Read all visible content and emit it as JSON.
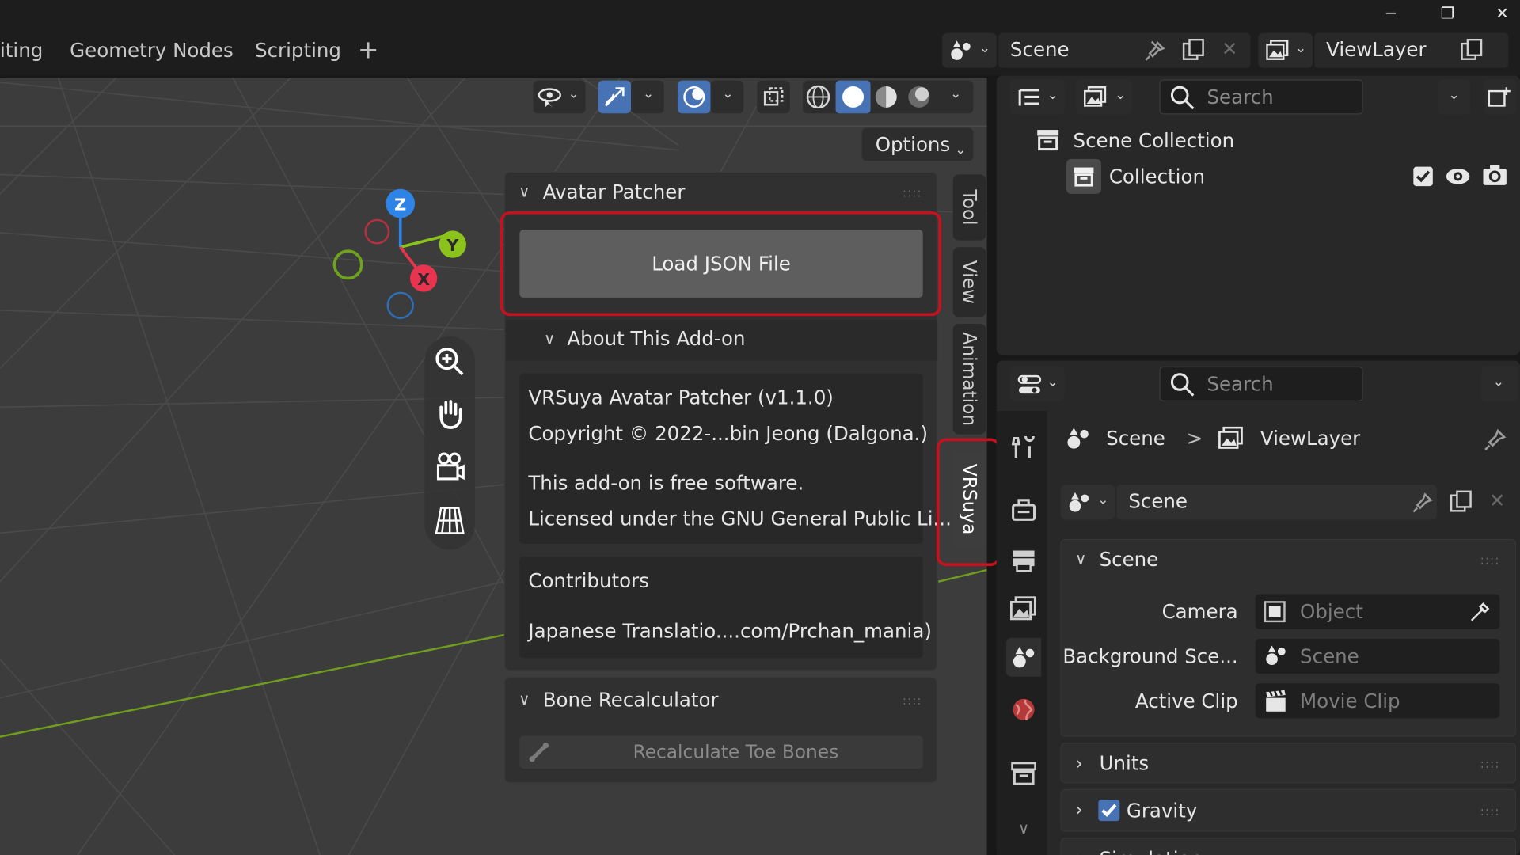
{
  "workspace_tabs": [
    "iting",
    "Geometry Nodes",
    "Scripting"
  ],
  "add_tab": "+",
  "scene_selector": {
    "value": "Scene"
  },
  "viewlayer_selector": {
    "value": "ViewLayer"
  },
  "window_controls": {
    "minimize": "─",
    "maximize": "❐",
    "close": "✕"
  },
  "viewport": {
    "options_label": "Options",
    "gizmo_axes": {
      "z": "Z",
      "y": "Y",
      "x": "X"
    }
  },
  "sidebar_tabs": [
    "Tool",
    "View",
    "Animation",
    "VRSuya"
  ],
  "avatar_patcher": {
    "title": "Avatar Patcher",
    "load_button": "Load JSON File",
    "about_title": "About This Add-on",
    "about_lines": [
      "VRSuya Avatar Patcher (v1.1.0)",
      "Copyright © 2022-...bin Jeong (Dalgona.)",
      "This add-on is free software.",
      "Licensed under the GNU General Public Li..."
    ],
    "contributors_title": "Contributors",
    "contributors_line": "Japanese Translatio....com/Prchan_mania)"
  },
  "bone_recalculator": {
    "title": "Bone Recalculator",
    "button": "Recalculate Toe Bones"
  },
  "outliner": {
    "search_placeholder": "Search",
    "scene_collection": "Scene Collection",
    "collection": "Collection"
  },
  "properties": {
    "search_placeholder": "Search",
    "breadcrumb": {
      "scene": "Scene",
      "separator": ">",
      "viewlayer": "ViewLayer"
    },
    "scene_field": "Scene",
    "section_scene": "Scene",
    "camera_label": "Camera",
    "camera_value": "Object",
    "background_label": "Background Sce...",
    "background_value": "Scene",
    "clip_label": "Active Clip",
    "clip_value": "Movie Clip",
    "section_units": "Units",
    "section_gravity": "Gravity",
    "section_simulation": "Simulation"
  },
  "colors": {
    "accent_blue": "#4772b3",
    "highlight_red": "#c8101e",
    "axis_x": "#e8344e",
    "axis_y": "#8bc21c",
    "axis_z": "#2e84e6"
  }
}
